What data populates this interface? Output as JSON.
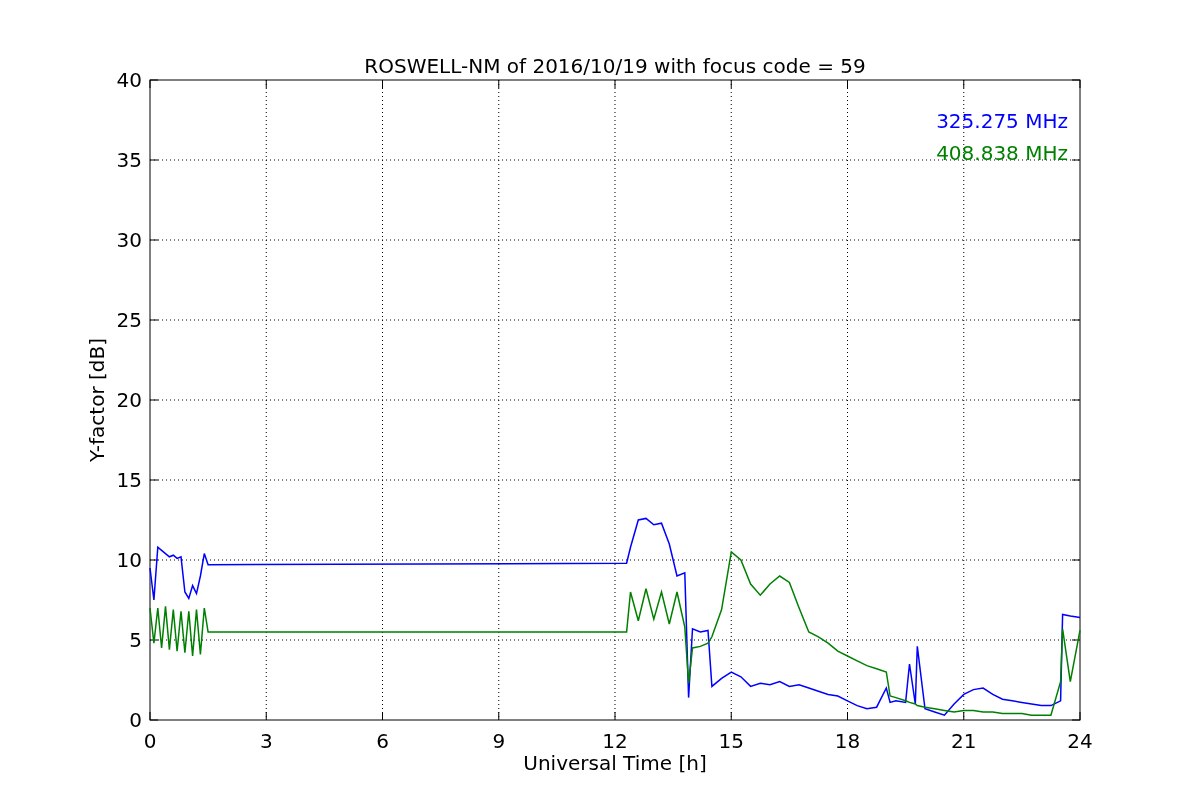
{
  "chart_data": {
    "type": "line",
    "title": "ROSWELL-NM of 2016/10/19 with focus code = 59",
    "xlabel": "Universal Time [h]",
    "ylabel": "Y-factor [dB]",
    "x": [
      0,
      0.1,
      0.2,
      0.3,
      0.4,
      0.5,
      0.6,
      0.7,
      0.8,
      0.9,
      1.0,
      1.1,
      1.2,
      1.3,
      1.4,
      1.5,
      12.3,
      12.4,
      12.6,
      12.8,
      13.0,
      13.2,
      13.4,
      13.6,
      13.8,
      13.9,
      14.0,
      14.2,
      14.4,
      14.5,
      14.75,
      15.0,
      15.25,
      15.5,
      15.75,
      16.0,
      16.25,
      16.5,
      16.75,
      17.0,
      17.25,
      17.5,
      17.75,
      18.0,
      18.25,
      18.5,
      18.75,
      19.0,
      19.1,
      19.25,
      19.5,
      19.6,
      19.75,
      19.8,
      20.0,
      20.25,
      20.5,
      20.75,
      21.0,
      21.25,
      21.5,
      21.75,
      22.0,
      22.25,
      22.5,
      22.75,
      23.0,
      23.25,
      23.5,
      23.55,
      23.75,
      24.0
    ],
    "series": [
      {
        "name": "325.275 MHz",
        "color": "#0000ff",
        "values": [
          9.5,
          7.5,
          10.8,
          10.6,
          10.4,
          10.2,
          10.3,
          10.1,
          10.2,
          8.0,
          7.6,
          8.4,
          7.9,
          9.0,
          10.4,
          9.7,
          9.8,
          10.8,
          12.5,
          12.6,
          12.2,
          12.3,
          11.0,
          9.0,
          9.2,
          1.4,
          5.7,
          5.5,
          5.6,
          2.1,
          2.6,
          3.0,
          2.7,
          2.1,
          2.3,
          2.2,
          2.4,
          2.1,
          2.2,
          2.0,
          1.8,
          1.6,
          1.5,
          1.2,
          0.9,
          0.7,
          0.8,
          2.0,
          1.1,
          1.2,
          1.1,
          3.5,
          1.0,
          4.6,
          0.7,
          0.5,
          0.3,
          1.0,
          1.6,
          1.9,
          2.0,
          1.6,
          1.3,
          1.2,
          1.1,
          1.0,
          0.9,
          0.9,
          1.2,
          6.6,
          6.5,
          6.4
        ]
      },
      {
        "name": "408.838 MHz",
        "color": "#008000",
        "values": [
          7.0,
          4.8,
          7.0,
          4.5,
          7.1,
          4.4,
          6.9,
          4.3,
          6.8,
          4.2,
          6.8,
          4.0,
          6.9,
          4.1,
          7.0,
          5.5,
          5.5,
          8.0,
          6.2,
          8.2,
          6.3,
          8.0,
          6.0,
          8.0,
          5.8,
          2.3,
          4.5,
          4.6,
          4.8,
          5.2,
          6.9,
          10.5,
          10.0,
          8.5,
          7.8,
          8.5,
          9.0,
          8.6,
          7.0,
          5.5,
          5.2,
          4.8,
          4.3,
          4.0,
          3.7,
          3.4,
          3.2,
          3.0,
          1.5,
          1.4,
          1.2,
          1.1,
          1.0,
          0.9,
          0.8,
          0.7,
          0.6,
          0.5,
          0.6,
          0.6,
          0.5,
          0.5,
          0.4,
          0.4,
          0.4,
          0.3,
          0.3,
          0.3,
          2.4,
          5.7,
          2.4,
          5.6
        ]
      }
    ],
    "grid": true,
    "xlim": [
      0,
      24
    ],
    "ylim": [
      0,
      40
    ],
    "xticks": [
      0,
      3,
      6,
      9,
      12,
      15,
      18,
      21,
      24
    ],
    "yticks": [
      0,
      5,
      10,
      15,
      20,
      25,
      30,
      35,
      40
    ]
  }
}
